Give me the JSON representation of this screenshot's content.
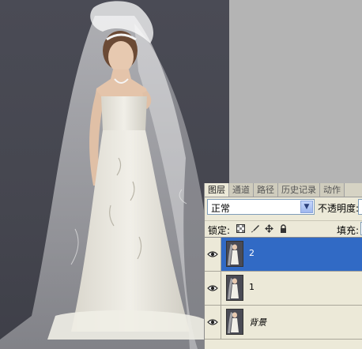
{
  "layers_panel": {
    "tabs": [
      "图层",
      "通道",
      "路径",
      "历史记录",
      "动作"
    ],
    "blend_mode": "正常",
    "opacity_label": "不透明度:",
    "lock_label": "锁定:",
    "fill_label": "填充:",
    "layers": [
      {
        "name": "2",
        "selected": true,
        "visible": true
      },
      {
        "name": "1",
        "selected": false,
        "visible": true
      },
      {
        "name": "背景",
        "selected": false,
        "visible": true
      }
    ]
  },
  "colors": {
    "selection": "#316ac5",
    "panel_bg": "#ece9d8",
    "photo_bg": "#464750",
    "canvas_gray": "#b4b4b4"
  },
  "icons": {
    "lock_transparency": "checker-icon",
    "lock_paint": "brush-icon",
    "lock_move": "move-icon",
    "lock_all": "padlock-icon",
    "visibility": "eye-icon",
    "dropdown": "chevron-down-icon"
  }
}
